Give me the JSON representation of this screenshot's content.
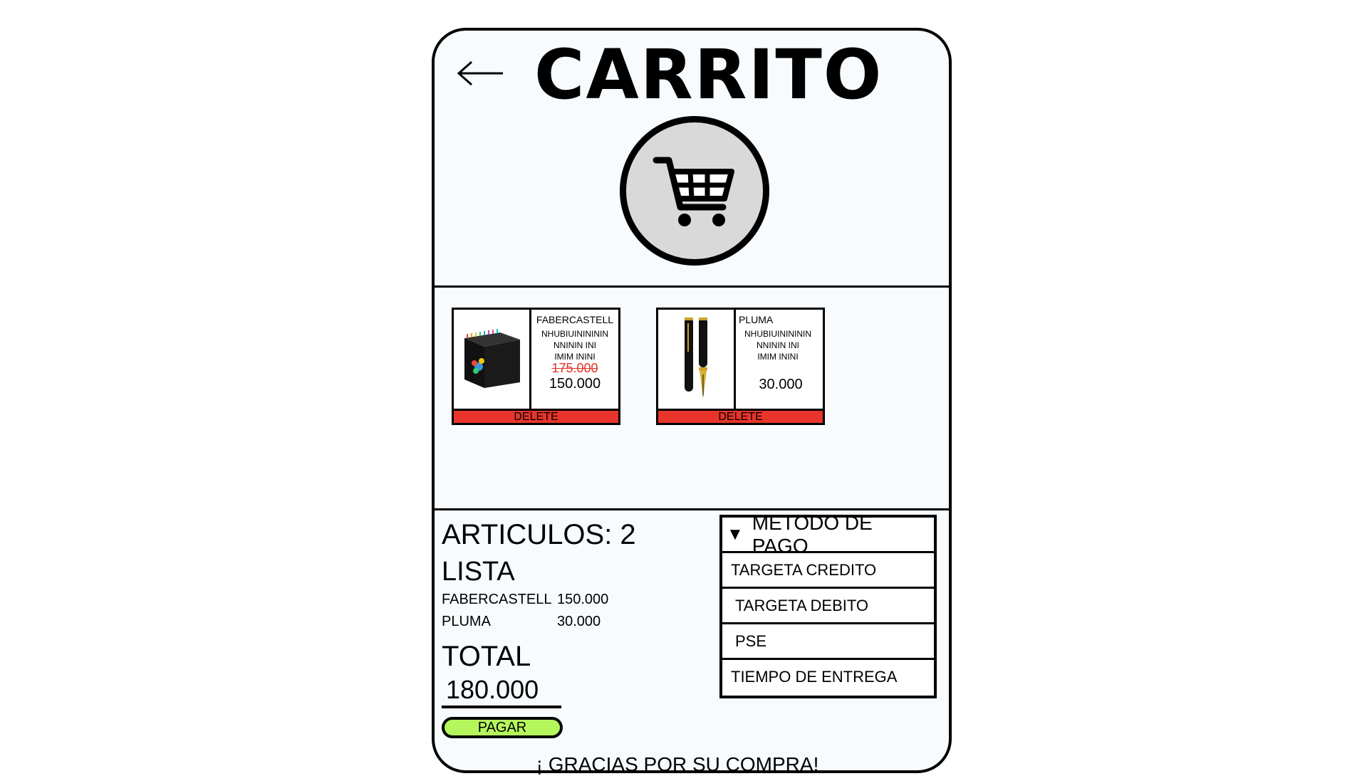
{
  "header": {
    "back_icon": "arrow-left-icon",
    "title": "CARRITO",
    "cart_icon": "shopping-cart-icon"
  },
  "products": [
    {
      "name": "FABERCASTELL",
      "desc_line1": "NHUBIUININININ",
      "desc_line2": "NNININ INI",
      "desc_line3": "IMIM ININI",
      "old_price": "175.000",
      "price": "150.000",
      "delete_label": "DELETE"
    },
    {
      "name": "PLUMA",
      "desc_line1": "NHUBIUININININ",
      "desc_line2": "NNININ INI",
      "desc_line3": "IMIM ININI",
      "price": "30.000",
      "delete_label": "DELETE"
    }
  ],
  "summary": {
    "articulos": "ARTICULOS: 2",
    "lista_label": "LISTA",
    "items": [
      {
        "name": "FABERCASTELL",
        "price": "150.000"
      },
      {
        "name": "PLUMA",
        "price": "30.000"
      }
    ],
    "total_label": "TOTAL",
    "total_value": "180.000",
    "pay_label": "PAGAR"
  },
  "payment_menu": {
    "header": "METODO DE PAGO",
    "options": [
      "TARGETA CREDITO",
      "TARGETA DEBITO",
      "PSE",
      "TIEMPO DE ENTREGA"
    ]
  },
  "footer": {
    "thanks": "¡ GRACIAS POR SU COMPRA!"
  },
  "colors": {
    "background": "#f7fbfe",
    "delete": "#e8342a",
    "pay_button": "#b6f65d",
    "strike_price": "#e0342a"
  }
}
